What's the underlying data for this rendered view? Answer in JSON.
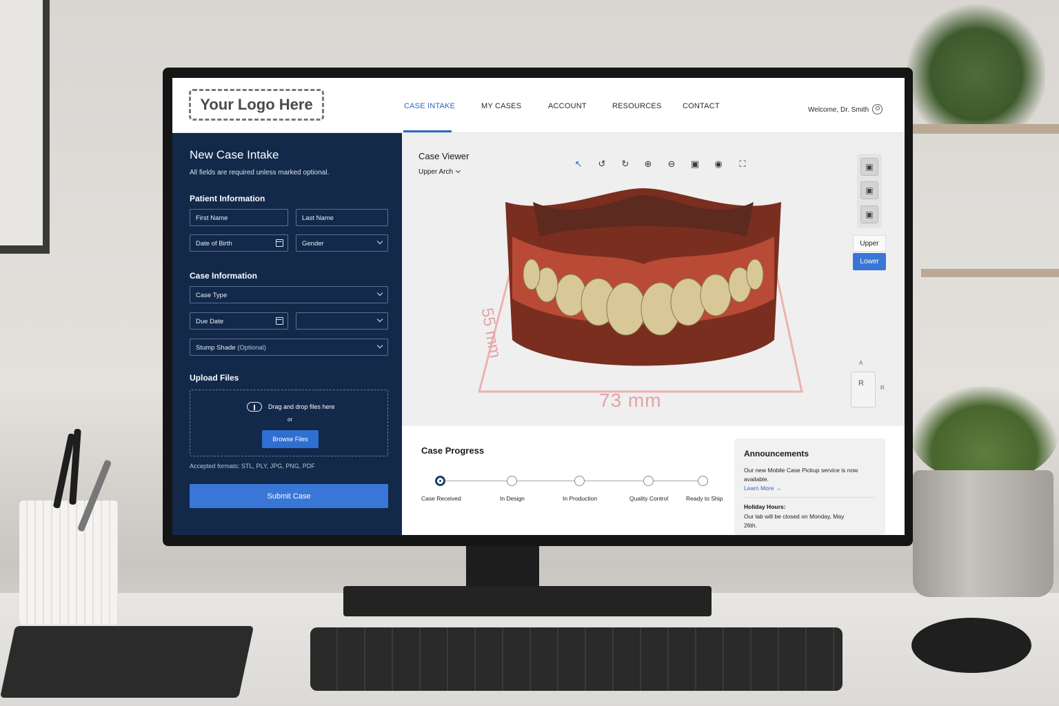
{
  "nav": {
    "logo": "Your Logo Here",
    "items": [
      "CASE INTAKE",
      "MY CASES",
      "ACCOUNT",
      "RESOURCES",
      "CONTACT"
    ],
    "active": "CASE INTAKE",
    "welcome": "Welcome, Dr. Smith",
    "user_icon": "user-circle-icon"
  },
  "form": {
    "title": "New Case Intake",
    "subtitle": "All fields are required unless marked optional.",
    "patient_section": "Patient Information",
    "first_name_placeholder": "First Name",
    "last_name_placeholder": "Last Name",
    "dob_placeholder": "Date of Birth",
    "gender_placeholder": "Gender",
    "case_section": "Case Information",
    "case_type": "Case Type",
    "due_date": "Due Date",
    "due_time": "",
    "stump_shade": "Stump Shade",
    "stump_optional": "(Optional)",
    "upload_section": "Upload Files",
    "drag_text": "Drag and drop files here",
    "or_text": "or",
    "browse_label": "Browse Files",
    "formats": "Accepted formats: STL, PLY, JPG, PNG, PDF",
    "submit_label": "Submit Case"
  },
  "viewer": {
    "title": "Case Viewer",
    "arch_select": "Upper Arch",
    "tools": [
      "pointer-icon",
      "undo-icon",
      "redo-icon",
      "zoom-in-icon",
      "zoom-out-icon",
      "fit-view-icon",
      "snapshot-icon",
      "fullscreen-icon"
    ],
    "view_modes": [
      "tooth-view-icon",
      "arch-view-icon",
      "occlusal-view-icon"
    ],
    "upper_label": "Upper",
    "lower_label": "Lower",
    "selected_jaw": "Lower",
    "dim_height": "55 mm",
    "dim_width": "73 mm",
    "cube_front": "R",
    "cube_top": "A",
    "cube_side": "R"
  },
  "progress": {
    "title": "Case Progress",
    "steps": [
      "Case Received",
      "In Design",
      "In Production",
      "Quality Control",
      "Ready to Ship"
    ],
    "current_step": 1
  },
  "announcements": {
    "title": "Announcements",
    "text": "Our new Mobile Case Pickup service is now available.",
    "link": "Learn More →",
    "holiday_title": "Holiday Hours:",
    "holiday_text": "Our lab will be closed on Monday, May 26th."
  },
  "colors": {
    "panel": "#12294a",
    "accent": "#3a76d6",
    "link": "#2c66c6"
  }
}
